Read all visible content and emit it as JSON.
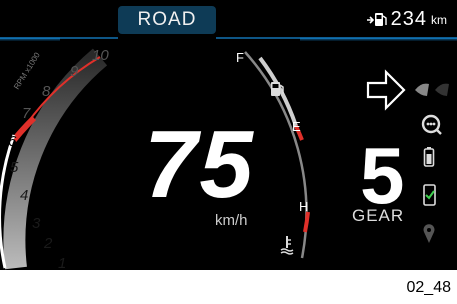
{
  "header": {
    "mode": "ROAD",
    "range_value": "234",
    "range_unit": "km",
    "range_icon": "fuel-range-icon"
  },
  "tachometer": {
    "label": "RPM x1000",
    "ticks": [
      "1",
      "2",
      "3",
      "4",
      "5",
      "6",
      "7",
      "8",
      "9",
      "10"
    ],
    "redline_color": "#e0302a"
  },
  "fuel_gauge": {
    "full_label": "F",
    "empty_label": "E",
    "icon": "fuel-pump-icon"
  },
  "temp_gauge": {
    "hot_label": "H",
    "icon": "coolant-temperature-icon"
  },
  "speed": {
    "value": "75",
    "unit": "km/h"
  },
  "gear": {
    "value": "5",
    "label": "GEAR"
  },
  "indicators": [
    "shift-up-arrow-icon",
    "turn-signal-icon",
    "connectivity-icon",
    "battery-icon",
    "phone-icon",
    "location-icon"
  ],
  "footer": {
    "code": "02_48"
  },
  "colors": {
    "accent_blue": "#1aa3ff",
    "tab_blue": "#0e3b56",
    "warning_red": "#e0302a"
  }
}
